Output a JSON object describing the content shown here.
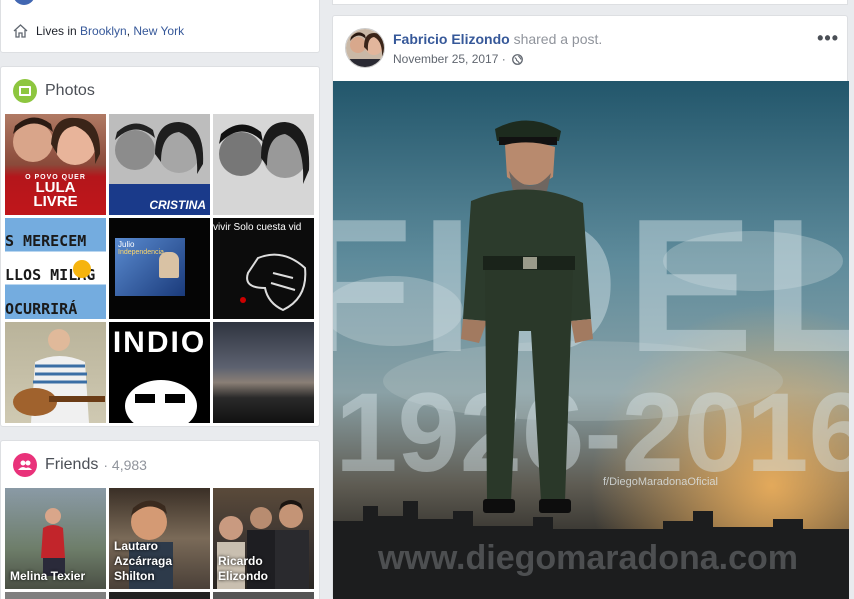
{
  "intro": {
    "lives_prefix": "Lives in",
    "city": "Brooklyn",
    "state": "New York"
  },
  "photos": {
    "title": "Photos",
    "tiles": [
      {
        "caption_top": "O POVO QUER",
        "caption_main1": "LULA",
        "caption_main2": "LIVRE"
      },
      {
        "caption": "CRISTINA"
      },
      {
        "caption": ""
      },
      {
        "lines": [
          "S MERECEM",
          "LLOS MILAG",
          "OCURRIRÁ"
        ]
      },
      {
        "line1": "Julio",
        "line2": "Independencia"
      },
      {
        "caption": "vivir Solo cuesta vid"
      },
      {
        "caption": ""
      },
      {
        "caption": "INDIO"
      },
      {
        "caption": ""
      }
    ]
  },
  "friends": {
    "title": "Friends",
    "count": "· 4,983",
    "items": [
      {
        "name": "Melina Texier"
      },
      {
        "name": "Lautaro Azcárraga Shilton"
      },
      {
        "name": "Ricardo Elizondo"
      }
    ]
  },
  "post": {
    "author": "Fabricio Elizondo",
    "action": "shared a post.",
    "date": "November 25, 2017 ·",
    "more": "•••",
    "image": {
      "big_word": "FIDEL",
      "years": "1926-2016",
      "watermark": "f/DiegoMaradonaOficial",
      "footer": "www.diegomaradona.com"
    }
  },
  "colors": {
    "link": "#365899",
    "photos_icon": "#8dc63f",
    "friends_icon": "#e9327a",
    "background": "#e9ebee"
  }
}
